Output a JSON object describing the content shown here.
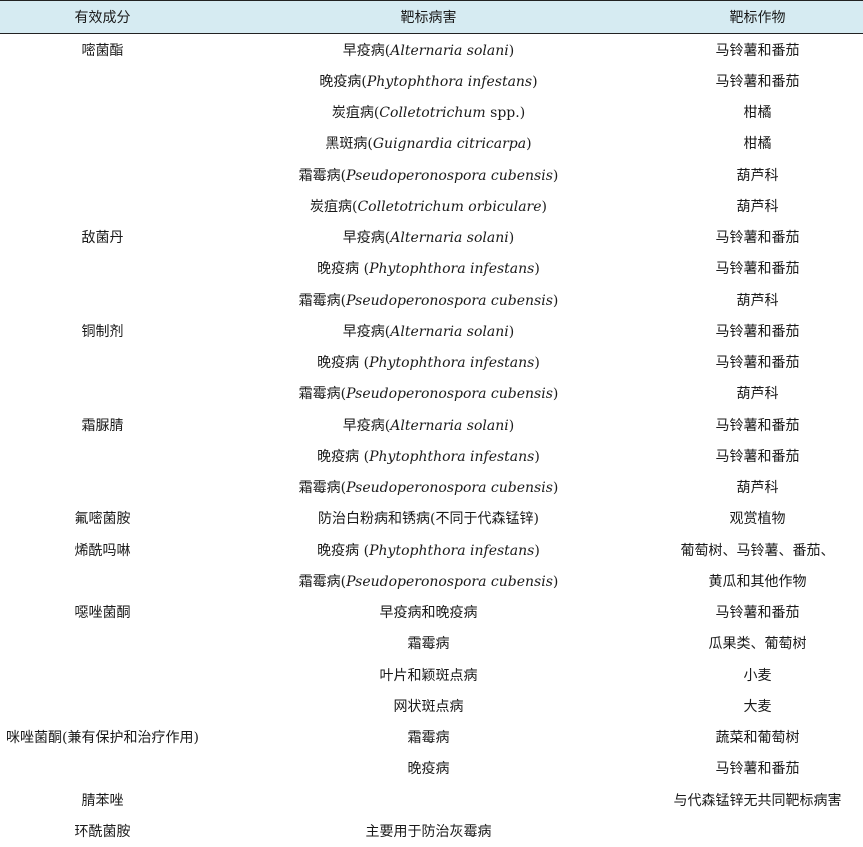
{
  "header": {
    "col1": "有效成分",
    "col2": "靶标病害",
    "col3": "靶标作物"
  },
  "rows": [
    {
      "ingredient": "嘧菌酯",
      "disease_prefix": "早疫病(",
      "disease_italic": "Alternaria solani",
      "disease_suffix": ")",
      "crop": "马铃薯和番茄"
    },
    {
      "ingredient": "",
      "disease_prefix": "晚疫病(",
      "disease_italic": "Phytophthora infestans",
      "disease_suffix": ")",
      "crop": "马铃薯和番茄"
    },
    {
      "ingredient": "",
      "disease_prefix": "炭疽病(",
      "disease_italic": "Colletotrichum",
      "disease_suffix": " spp.)",
      "crop": "柑橘"
    },
    {
      "ingredient": "",
      "disease_prefix": "黑斑病(",
      "disease_italic": "Guignardia citricarpa",
      "disease_suffix": ")",
      "crop": "柑橘"
    },
    {
      "ingredient": "",
      "disease_prefix": "霜霉病(",
      "disease_italic": "Pseudoperonospora cubensis",
      "disease_suffix": ")",
      "crop": "葫芦科"
    },
    {
      "ingredient": "",
      "disease_prefix": "炭疽病(",
      "disease_italic": "Colletotrichum orbiculare",
      "disease_suffix": ")",
      "crop": "葫芦科"
    },
    {
      "ingredient": "敌菌丹",
      "disease_prefix": "早疫病(",
      "disease_italic": "Alternaria solani",
      "disease_suffix": ")",
      "crop": "马铃薯和番茄"
    },
    {
      "ingredient": "",
      "disease_prefix": "晚疫病 (",
      "disease_italic": "Phytophthora infestans",
      "disease_suffix": ")",
      "crop": "马铃薯和番茄"
    },
    {
      "ingredient": "",
      "disease_prefix": "霜霉病(",
      "disease_italic": "Pseudoperonospora cubensis",
      "disease_suffix": ")",
      "crop": "葫芦科"
    },
    {
      "ingredient": "铜制剂",
      "disease_prefix": "早疫病(",
      "disease_italic": "Alternaria solani",
      "disease_suffix": ")",
      "crop": "马铃薯和番茄"
    },
    {
      "ingredient": "",
      "disease_prefix": "晚疫病 (",
      "disease_italic": "Phytophthora infestans",
      "disease_suffix": ")",
      "crop": "马铃薯和番茄"
    },
    {
      "ingredient": "",
      "disease_prefix": "霜霉病(",
      "disease_italic": "Pseudoperonospora cubensis",
      "disease_suffix": ")",
      "crop": "葫芦科"
    },
    {
      "ingredient": "霜脲腈",
      "disease_prefix": "早疫病(",
      "disease_italic": "Alternaria solani",
      "disease_suffix": ")",
      "crop": "马铃薯和番茄"
    },
    {
      "ingredient": "",
      "disease_prefix": "晚疫病 (",
      "disease_italic": "Phytophthora infestans",
      "disease_suffix": ")",
      "crop": "马铃薯和番茄"
    },
    {
      "ingredient": "",
      "disease_prefix": "霜霉病(",
      "disease_italic": "Pseudoperonospora cubensis",
      "disease_suffix": ")",
      "crop": "葫芦科"
    },
    {
      "ingredient": "氟嘧菌胺",
      "disease_prefix": "防治白粉病和锈病(不同于代森锰锌)",
      "disease_italic": "",
      "disease_suffix": "",
      "crop": "观赏植物"
    },
    {
      "ingredient": "烯酰吗啉",
      "disease_prefix": "晚疫病 (",
      "disease_italic": "Phytophthora infestans",
      "disease_suffix": ")",
      "crop": "葡萄树、马铃薯、番茄、"
    },
    {
      "ingredient": "",
      "disease_prefix": "霜霉病(",
      "disease_italic": "Pseudoperonospora cubensis",
      "disease_suffix": ")",
      "crop": "黄瓜和其他作物"
    },
    {
      "ingredient": "噁唑菌酮",
      "disease_prefix": "早疫病和晚疫病",
      "disease_italic": "",
      "disease_suffix": "",
      "crop": "马铃薯和番茄"
    },
    {
      "ingredient": "",
      "disease_prefix": "霜霉病",
      "disease_italic": "",
      "disease_suffix": "",
      "crop": "瓜果类、葡萄树"
    },
    {
      "ingredient": "",
      "disease_prefix": "叶片和颖斑点病",
      "disease_italic": "",
      "disease_suffix": "",
      "crop": "小麦"
    },
    {
      "ingredient": "",
      "disease_prefix": "网状斑点病",
      "disease_italic": "",
      "disease_suffix": "",
      "crop": "大麦"
    },
    {
      "ingredient": "咪唑菌酮(兼有保护和治疗作用)",
      "disease_prefix": "霜霉病",
      "disease_italic": "",
      "disease_suffix": "",
      "crop": "蔬菜和葡萄树"
    },
    {
      "ingredient": "",
      "disease_prefix": "晚疫病",
      "disease_italic": "",
      "disease_suffix": "",
      "crop": "马铃薯和番茄"
    },
    {
      "ingredient": "腈苯唑",
      "disease_prefix": "",
      "disease_italic": "",
      "disease_suffix": "",
      "crop": "与代森锰锌无共同靶标病害"
    },
    {
      "ingredient": "环酰菌胺",
      "disease_prefix": "主要用于防治灰霉病",
      "disease_italic": "",
      "disease_suffix": "",
      "crop": ""
    }
  ]
}
